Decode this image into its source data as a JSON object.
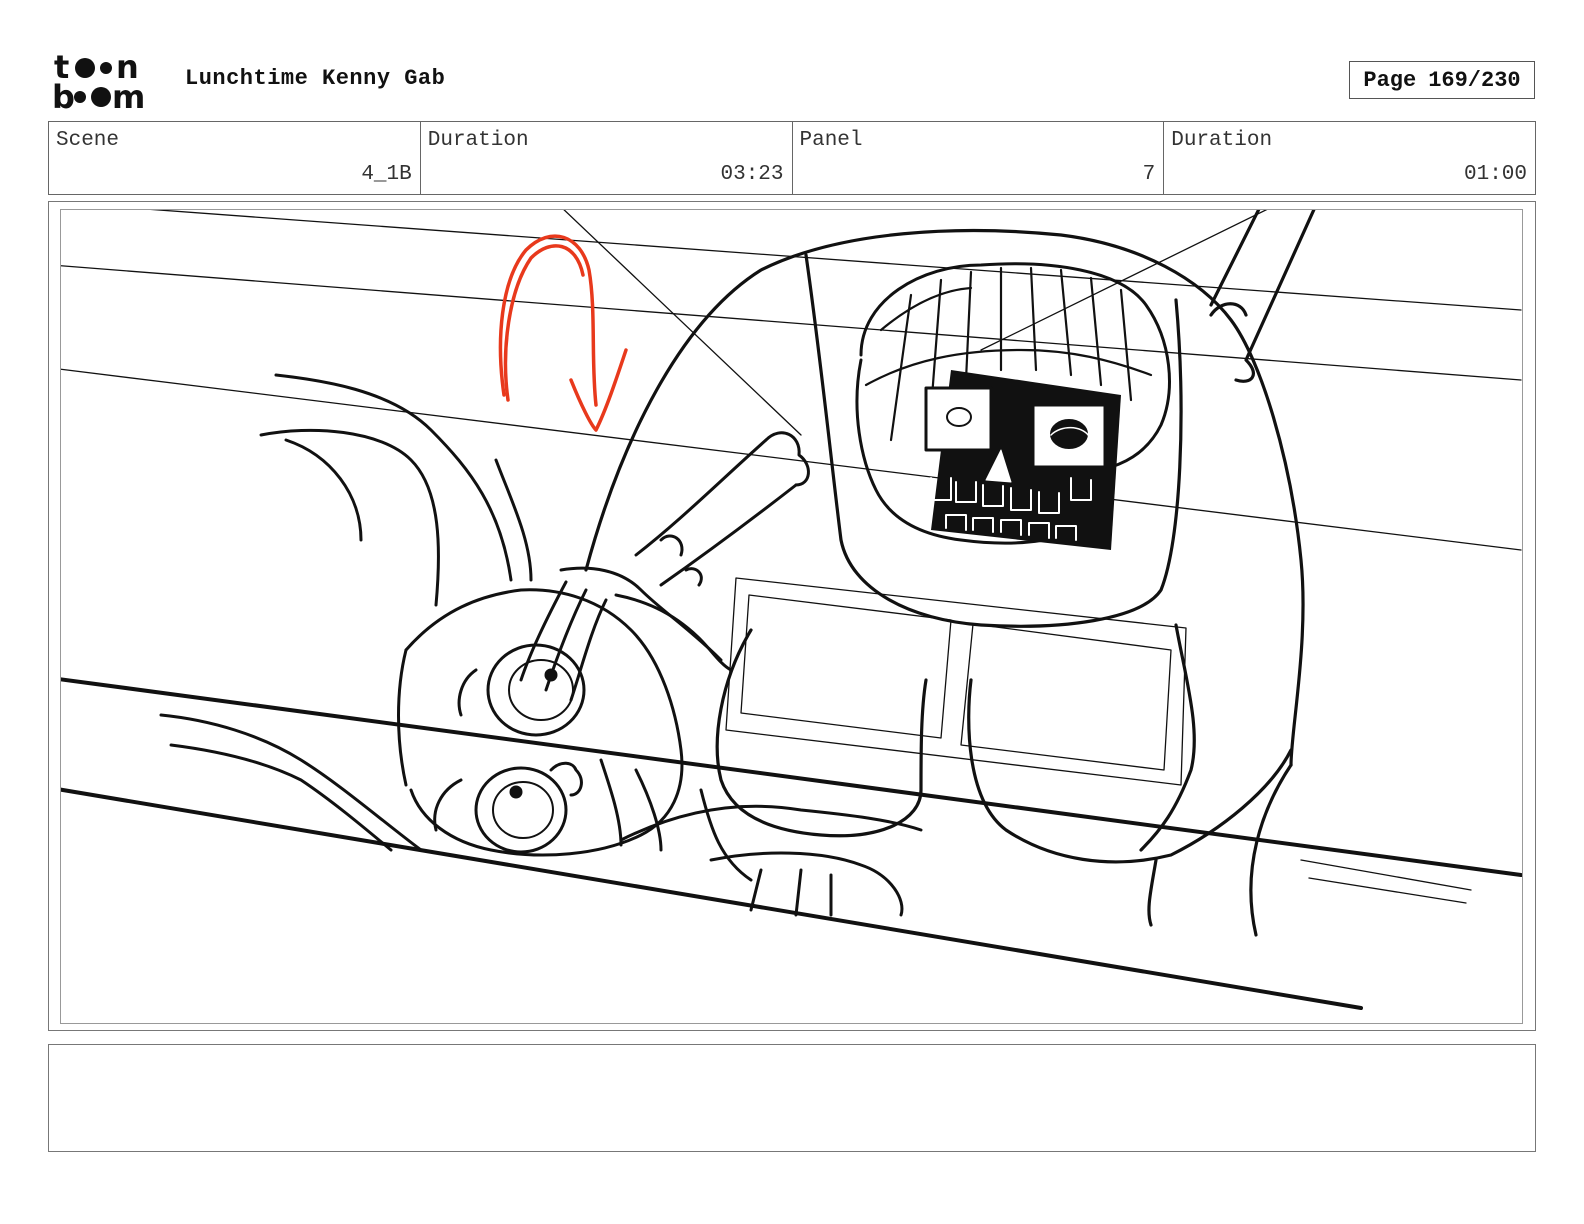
{
  "header": {
    "logo_text_top": "toon",
    "logo_text_bottom": "boom",
    "project_title": "Lunchtime Kenny Gab",
    "page_label": "Page",
    "page_number": "169/230"
  },
  "info_bar": [
    {
      "label": "Scene",
      "value": "4_1B"
    },
    {
      "label": "Duration",
      "value": "03:23"
    },
    {
      "label": "Panel",
      "value": "7"
    },
    {
      "label": "Duration",
      "value": "01:00"
    }
  ],
  "panel": {
    "sketch_subject": "rough storyboard drawing: a skeletal creature reaches over a wall to grab a wide-eyed fox-eared character",
    "arrow_color": "#e8391c",
    "ink_color": "#111111"
  },
  "notes": {
    "text": ""
  }
}
